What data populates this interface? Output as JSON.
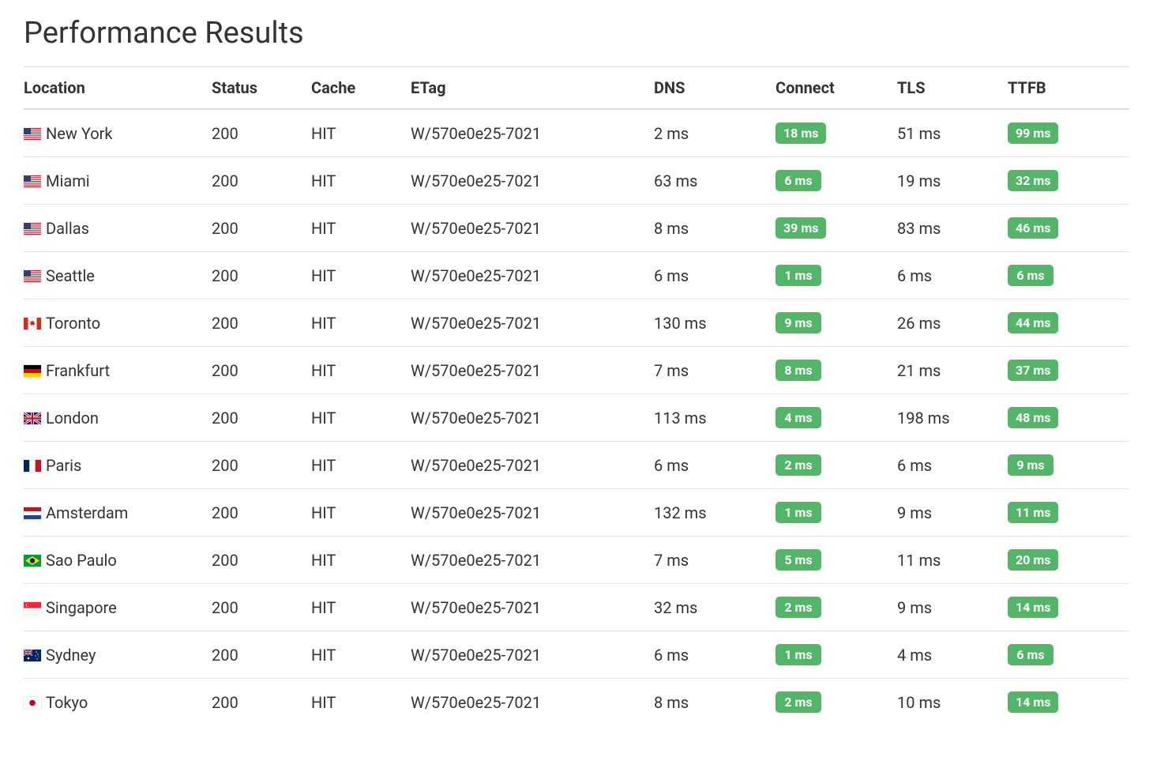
{
  "title": "Performance Results",
  "columns": [
    "Location",
    "Status",
    "Cache",
    "ETag",
    "DNS",
    "Connect",
    "TLS",
    "TTFB"
  ],
  "rows": [
    {
      "flag": "us",
      "location": "New York",
      "status": "200",
      "cache": "HIT",
      "etag": "W/570e0e25-7021",
      "dns": "2 ms",
      "connect": "18 ms",
      "tls": "51 ms",
      "ttfb": "99 ms"
    },
    {
      "flag": "us",
      "location": "Miami",
      "status": "200",
      "cache": "HIT",
      "etag": "W/570e0e25-7021",
      "dns": "63 ms",
      "connect": "6 ms",
      "tls": "19 ms",
      "ttfb": "32 ms"
    },
    {
      "flag": "us",
      "location": "Dallas",
      "status": "200",
      "cache": "HIT",
      "etag": "W/570e0e25-7021",
      "dns": "8 ms",
      "connect": "39 ms",
      "tls": "83 ms",
      "ttfb": "46 ms"
    },
    {
      "flag": "us",
      "location": "Seattle",
      "status": "200",
      "cache": "HIT",
      "etag": "W/570e0e25-7021",
      "dns": "6 ms",
      "connect": "1 ms",
      "tls": "6 ms",
      "ttfb": "6 ms"
    },
    {
      "flag": "ca",
      "location": "Toronto",
      "status": "200",
      "cache": "HIT",
      "etag": "W/570e0e25-7021",
      "dns": "130 ms",
      "connect": "9 ms",
      "tls": "26 ms",
      "ttfb": "44 ms"
    },
    {
      "flag": "de",
      "location": "Frankfurt",
      "status": "200",
      "cache": "HIT",
      "etag": "W/570e0e25-7021",
      "dns": "7 ms",
      "connect": "8 ms",
      "tls": "21 ms",
      "ttfb": "37 ms"
    },
    {
      "flag": "gb",
      "location": "London",
      "status": "200",
      "cache": "HIT",
      "etag": "W/570e0e25-7021",
      "dns": "113 ms",
      "connect": "4 ms",
      "tls": "198 ms",
      "ttfb": "48 ms"
    },
    {
      "flag": "fr",
      "location": "Paris",
      "status": "200",
      "cache": "HIT",
      "etag": "W/570e0e25-7021",
      "dns": "6 ms",
      "connect": "2 ms",
      "tls": "6 ms",
      "ttfb": "9 ms"
    },
    {
      "flag": "nl",
      "location": "Amsterdam",
      "status": "200",
      "cache": "HIT",
      "etag": "W/570e0e25-7021",
      "dns": "132 ms",
      "connect": "1 ms",
      "tls": "9 ms",
      "ttfb": "11 ms"
    },
    {
      "flag": "br",
      "location": "Sao Paulo",
      "status": "200",
      "cache": "HIT",
      "etag": "W/570e0e25-7021",
      "dns": "7 ms",
      "connect": "5 ms",
      "tls": "11 ms",
      "ttfb": "20 ms"
    },
    {
      "flag": "sg",
      "location": "Singapore",
      "status": "200",
      "cache": "HIT",
      "etag": "W/570e0e25-7021",
      "dns": "32 ms",
      "connect": "2 ms",
      "tls": "9 ms",
      "ttfb": "14 ms"
    },
    {
      "flag": "au",
      "location": "Sydney",
      "status": "200",
      "cache": "HIT",
      "etag": "W/570e0e25-7021",
      "dns": "6 ms",
      "connect": "1 ms",
      "tls": "4 ms",
      "ttfb": "6 ms"
    },
    {
      "flag": "jp",
      "location": "Tokyo",
      "status": "200",
      "cache": "HIT",
      "etag": "W/570e0e25-7021",
      "dns": "8 ms",
      "connect": "2 ms",
      "tls": "10 ms",
      "ttfb": "14 ms"
    }
  ]
}
